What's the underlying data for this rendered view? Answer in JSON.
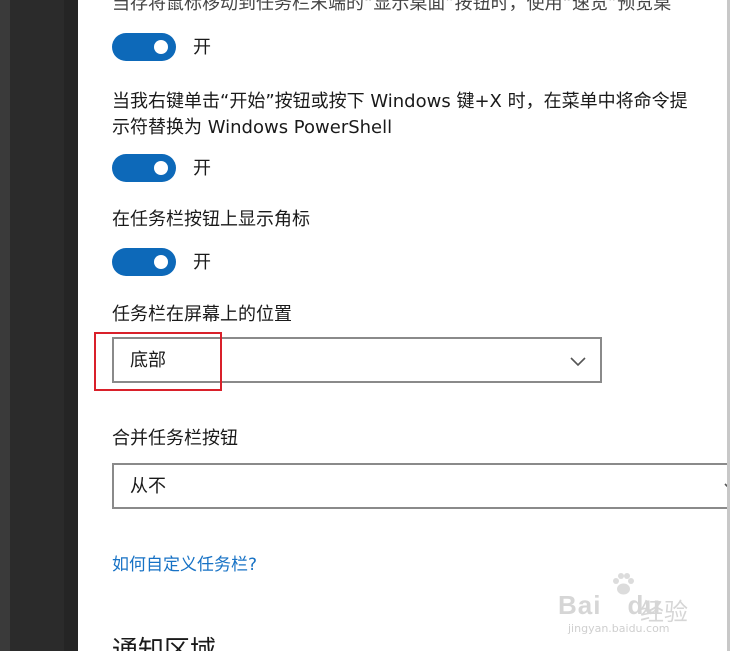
{
  "settings": {
    "top_cut_text": "当存将鼠标移动到任务栏末端的“显示桌面”按钮时，使用“速览”预览桌",
    "toggle1": {
      "state_label": "开",
      "on": true
    },
    "powershell_setting": {
      "line1": "当我右键单击“开始”按钮或按下 Windows 键+X 时，在菜单中将命令提",
      "line2": "示符替换为 Windows PowerShell"
    },
    "toggle2": {
      "state_label": "开",
      "on": true
    },
    "badges_setting": {
      "label": "在任务栏按钮上显示角标"
    },
    "toggle3": {
      "state_label": "开",
      "on": true
    },
    "position_setting": {
      "label": "任务栏在屏幕上的位置",
      "value": "底部"
    },
    "combine_setting": {
      "label": "合并任务栏按钮",
      "value": "从不"
    },
    "help_link": "如何自定义任务栏?",
    "next_section_title": "通知区域"
  },
  "watermark": {
    "brand": "Bai",
    "brand_suffix": "du",
    "brand_cn": "经验",
    "url": "jingyan.baidu.com"
  },
  "colors": {
    "toggle_on": "#0d69b9",
    "link": "#1772c5",
    "highlight_box": "#d9202a"
  }
}
